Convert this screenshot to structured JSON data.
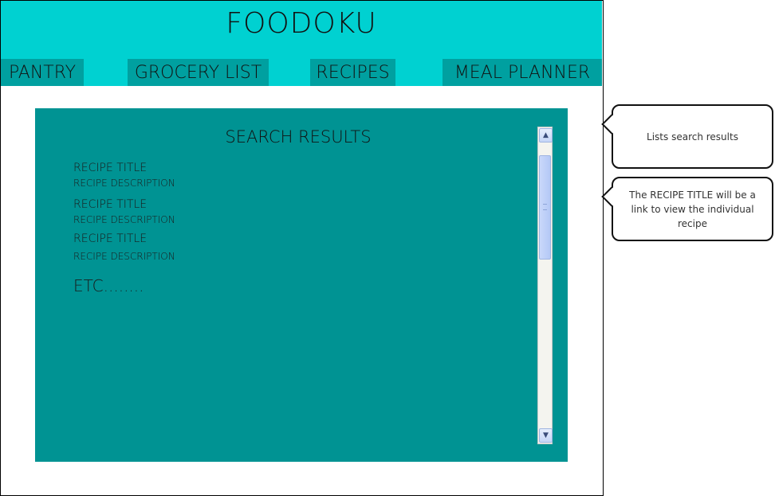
{
  "app": {
    "title": "FOODOKU"
  },
  "nav": {
    "tabs": [
      {
        "label": "PANTRY"
      },
      {
        "label": "GROCERY LIST"
      },
      {
        "label": "RECIPES"
      },
      {
        "label": "MEAL PLANNER"
      }
    ]
  },
  "results": {
    "heading": "SEARCH RESULTS",
    "items": [
      {
        "title": "RECIPE TITLE",
        "description": "RECIPE DESCRIPTION"
      },
      {
        "title": "RECIPE TITLE",
        "description": "RECIPE DESCRIPTION"
      },
      {
        "title": "RECIPE TITLE",
        "description": "RECIPE DESCRIPTION"
      }
    ],
    "more": "ETC........"
  },
  "scrollbar": {
    "up_icon": "chevron-up-icon",
    "down_icon": "chevron-down-icon"
  },
  "annotations": {
    "search_note": "Lists search results",
    "link_note": "The RECIPE TITLE will be a link to view the individual recipe"
  },
  "colors": {
    "header_bg": "#00d1d1",
    "tab_bg": "#00a0a0",
    "panel_bg": "#009393"
  }
}
